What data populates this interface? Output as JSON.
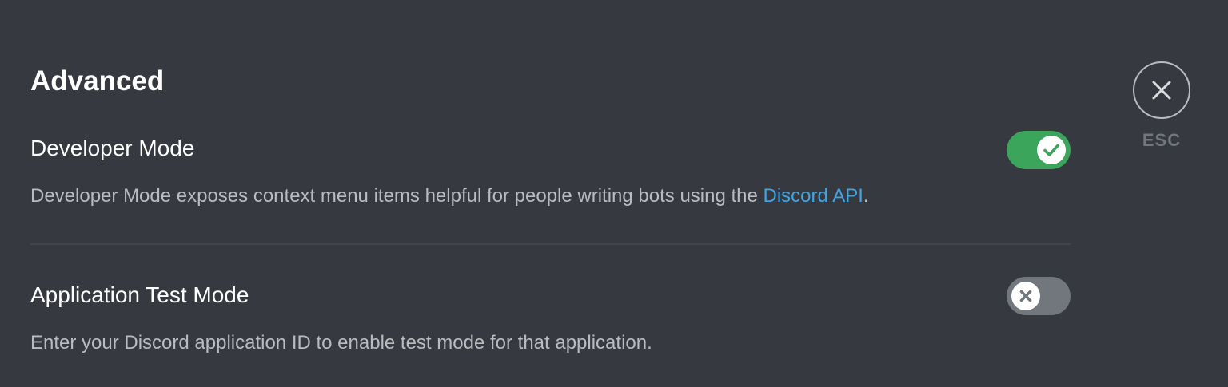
{
  "section": {
    "title": "Advanced"
  },
  "settings": [
    {
      "title": "Developer Mode",
      "description_prefix": "Developer Mode exposes context menu items helpful for people writing bots using the ",
      "link_text": "Discord API",
      "description_suffix": ".",
      "enabled": true,
      "toggle_icon": "check-icon"
    },
    {
      "title": "Application Test Mode",
      "description": "Enter your Discord application ID to enable test mode for that application.",
      "enabled": false,
      "toggle_icon": "x-icon"
    }
  ],
  "close": {
    "label": "ESC",
    "icon": "close-icon"
  },
  "colors": {
    "background": "#36393f",
    "toggle_on": "#3ba55c",
    "toggle_off": "#72767d",
    "link": "#3ea6e6"
  }
}
